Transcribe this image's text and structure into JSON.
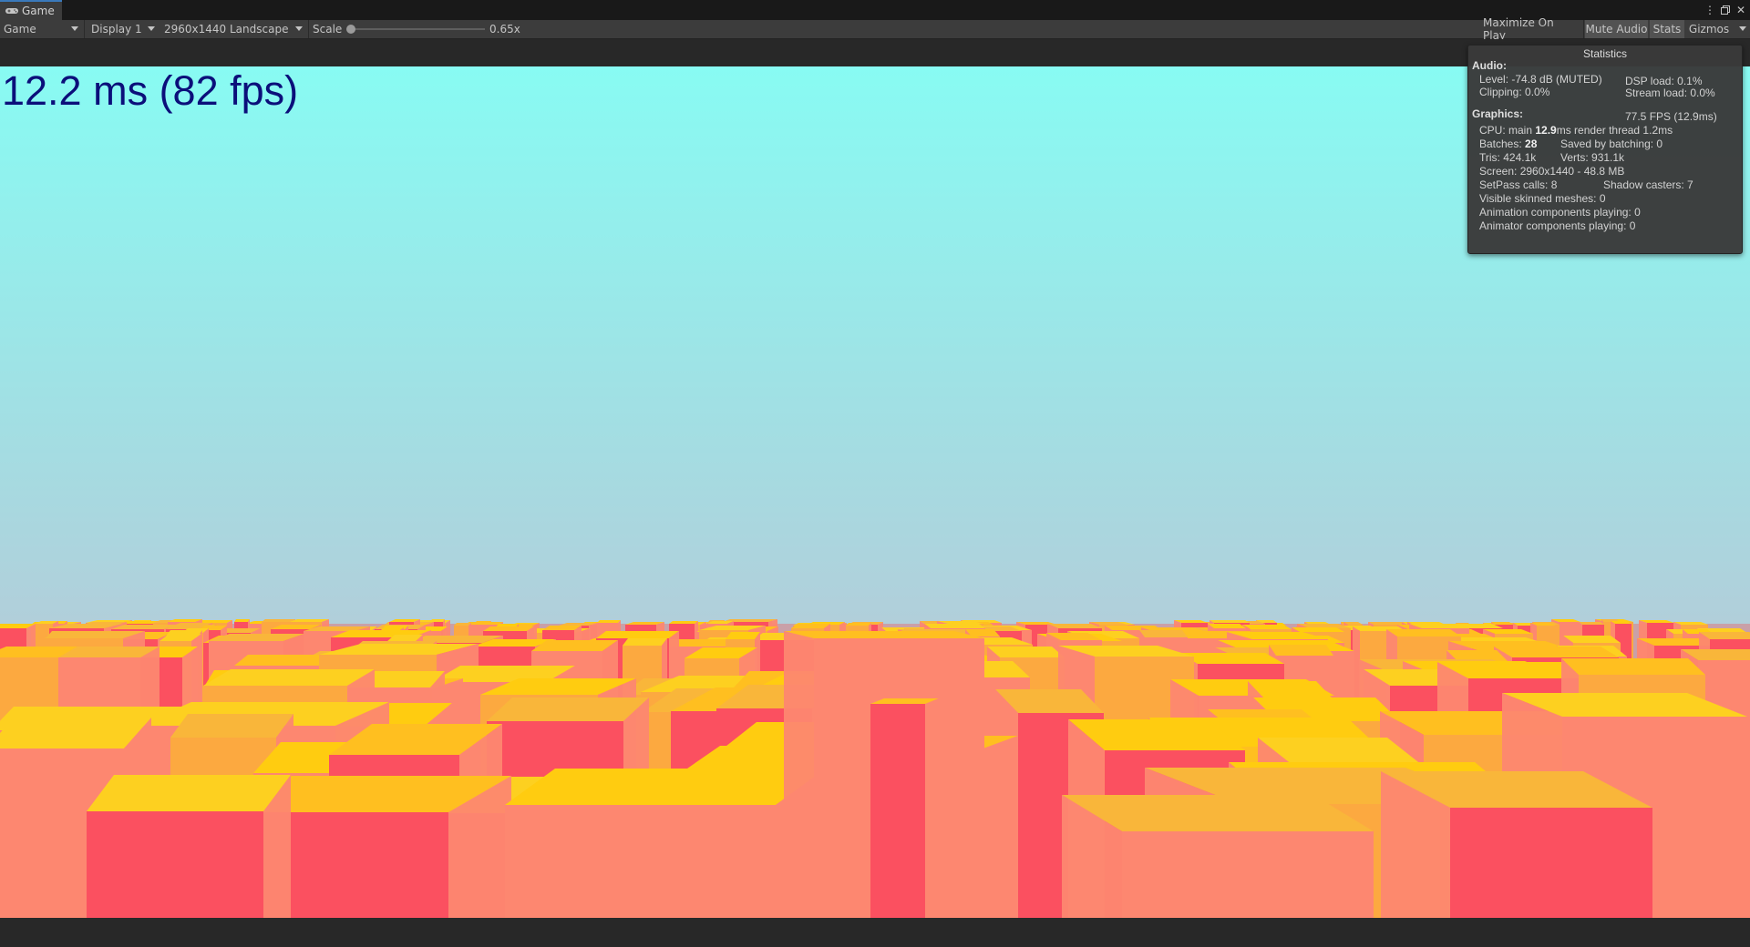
{
  "tab": {
    "label": "Game",
    "icon": "gamepad-icon"
  },
  "window_controls": {
    "menu": "⋮",
    "maximize": "🗖",
    "close": "✕"
  },
  "toolbar": {
    "view_mode": "Game",
    "display": "Display 1",
    "resolution": "2960x1440 Landscape",
    "scale_label": "Scale",
    "scale_value": "0.65x",
    "maximize_on_play": "Maximize On Play",
    "mute_audio": "Mute Audio",
    "stats": "Stats",
    "gizmos": "Gizmos",
    "active_toggles": [
      "mute_audio",
      "stats"
    ]
  },
  "overlay": {
    "frame_time": "12.2 ms (82 fps)",
    "color": "#0b0f7a"
  },
  "stats": {
    "title": "Statistics",
    "audio": {
      "header": "Audio:",
      "level": "Level: -74.8 dB (MUTED)",
      "dsp_load": "DSP load: 0.1%",
      "clipping": "Clipping: 0.0%",
      "stream_load": "Stream load: 0.0%"
    },
    "graphics": {
      "header": "Graphics:",
      "fps": "77.5 FPS (12.9ms)",
      "cpu_prefix": "CPU: main ",
      "cpu_main": "12.9",
      "cpu_suffix": "ms  render thread 1.2ms",
      "batches_prefix": "Batches: ",
      "batches": "28",
      "saved_by_batching": "Saved by batching: 0",
      "tris": "Tris: 424.1k",
      "verts": "Verts: 931.1k",
      "screen": "Screen: 2960x1440 - 48.8 MB",
      "setpass": "SetPass calls: 8",
      "shadow_casters": "Shadow casters: 7",
      "skinned_meshes": "Visible skinned meshes: 0",
      "animation_components": "Animation components playing: 0",
      "animator_components": "Animator components playing: 0"
    }
  },
  "scene_colors": {
    "sky_top": "#88fbf3",
    "sky_bottom": "#c7b7cd",
    "building_red": "#fb5060",
    "building_salmon": "#fd8770",
    "building_orange": "#fca940",
    "rooftop_yellow": "#ffcc10"
  }
}
